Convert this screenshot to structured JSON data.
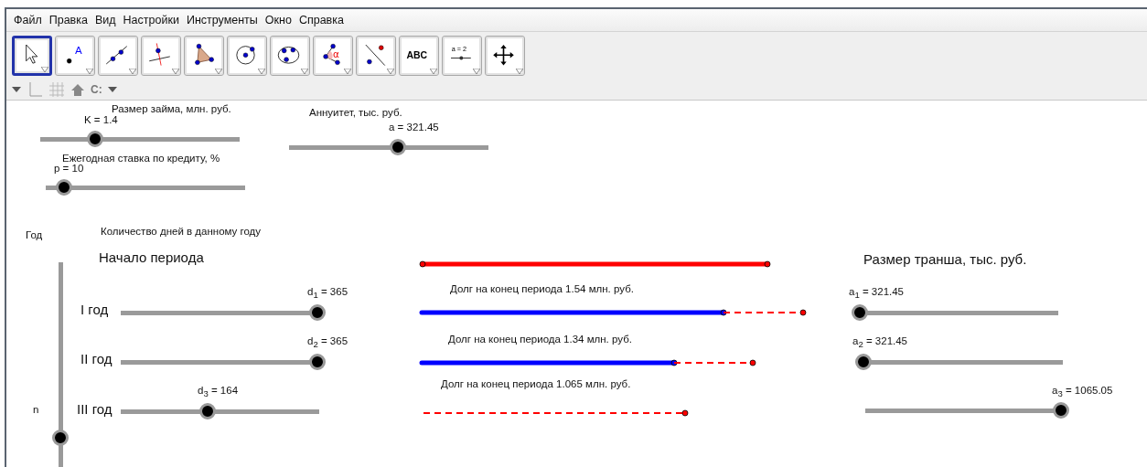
{
  "menu": [
    "Файл",
    "Правка",
    "Вид",
    "Настройки",
    "Инструменты",
    "Окно",
    "Справка"
  ],
  "toolbar": [
    {
      "kind": "move",
      "selected": true
    },
    {
      "kind": "point",
      "glyph": "A",
      "selected": false
    },
    {
      "kind": "line",
      "selected": false
    },
    {
      "kind": "perpendicular",
      "selected": false
    },
    {
      "kind": "polygon",
      "selected": false
    },
    {
      "kind": "circle",
      "selected": false
    },
    {
      "kind": "conic",
      "selected": false
    },
    {
      "kind": "angle",
      "glyph": "α",
      "selected": false
    },
    {
      "kind": "reflect",
      "selected": false
    },
    {
      "kind": "text",
      "glyph": "ABC",
      "selected": false
    },
    {
      "kind": "slider",
      "glyph": "a = 2",
      "selected": false
    },
    {
      "kind": "move_view",
      "selected": false
    }
  ],
  "style_bar": {
    "capture": "C:"
  },
  "canvas": {
    "texts": [
      {
        "kind": "small",
        "text": "Год"
      },
      {
        "kind": "small",
        "text": "Количество дней в  данному году"
      },
      {
        "kind": "large",
        "text": "Начало периода"
      },
      {
        "kind": "large",
        "text": "Размер транша, тыс. руб."
      },
      {
        "kind": "large",
        "text": "I год"
      },
      {
        "kind": "large",
        "text": "II год"
      },
      {
        "kind": "large",
        "text": "III год"
      },
      {
        "kind": "small",
        "text": "Долг на конец периода 1.54 млн. руб."
      },
      {
        "kind": "small",
        "text": "Долг на конец периода 1.34 млн. руб."
      },
      {
        "kind": "small",
        "text": "Долг на конец периода 1.065 млн. руб."
      }
    ],
    "sliders": [
      {
        "caption": "Размер займа, млн. руб.",
        "value": "K = 1.4",
        "level": 0.275
      },
      {
        "caption": "Аннуитет, тыс. руб.",
        "value": "a = 321.45",
        "level": 0.546
      },
      {
        "caption": "Ежегодная ставка по кредиту, %",
        "value": "p = 10",
        "level": 0.09
      },
      {
        "value": "n",
        "level": 0.26
      },
      {
        "value": "d$_{1}$ = 365",
        "level": 1
      },
      {
        "value": "d$_{2}$ = 365",
        "level": 1
      },
      {
        "value": "d$_{3}$ = 164",
        "level": 0.44
      },
      {
        "value": "a$_{1}$ = 321.45",
        "level": 0
      },
      {
        "value": "a$_{2}$ = 321.45",
        "level": 0
      },
      {
        "value": "a$_{3}$ = 1065.05",
        "level": 1
      }
    ],
    "segments": [
      {
        "kind": "solid",
        "color": "#ff0000"
      },
      {
        "kind": "solid",
        "color": "#0000ff"
      },
      {
        "kind": "dashed",
        "color": "#ff0000"
      },
      {
        "kind": "solid",
        "color": "#0000ff"
      },
      {
        "kind": "dashed",
        "color": "#ff0000"
      },
      {
        "kind": "dashed",
        "color": "#ff0000"
      }
    ]
  }
}
